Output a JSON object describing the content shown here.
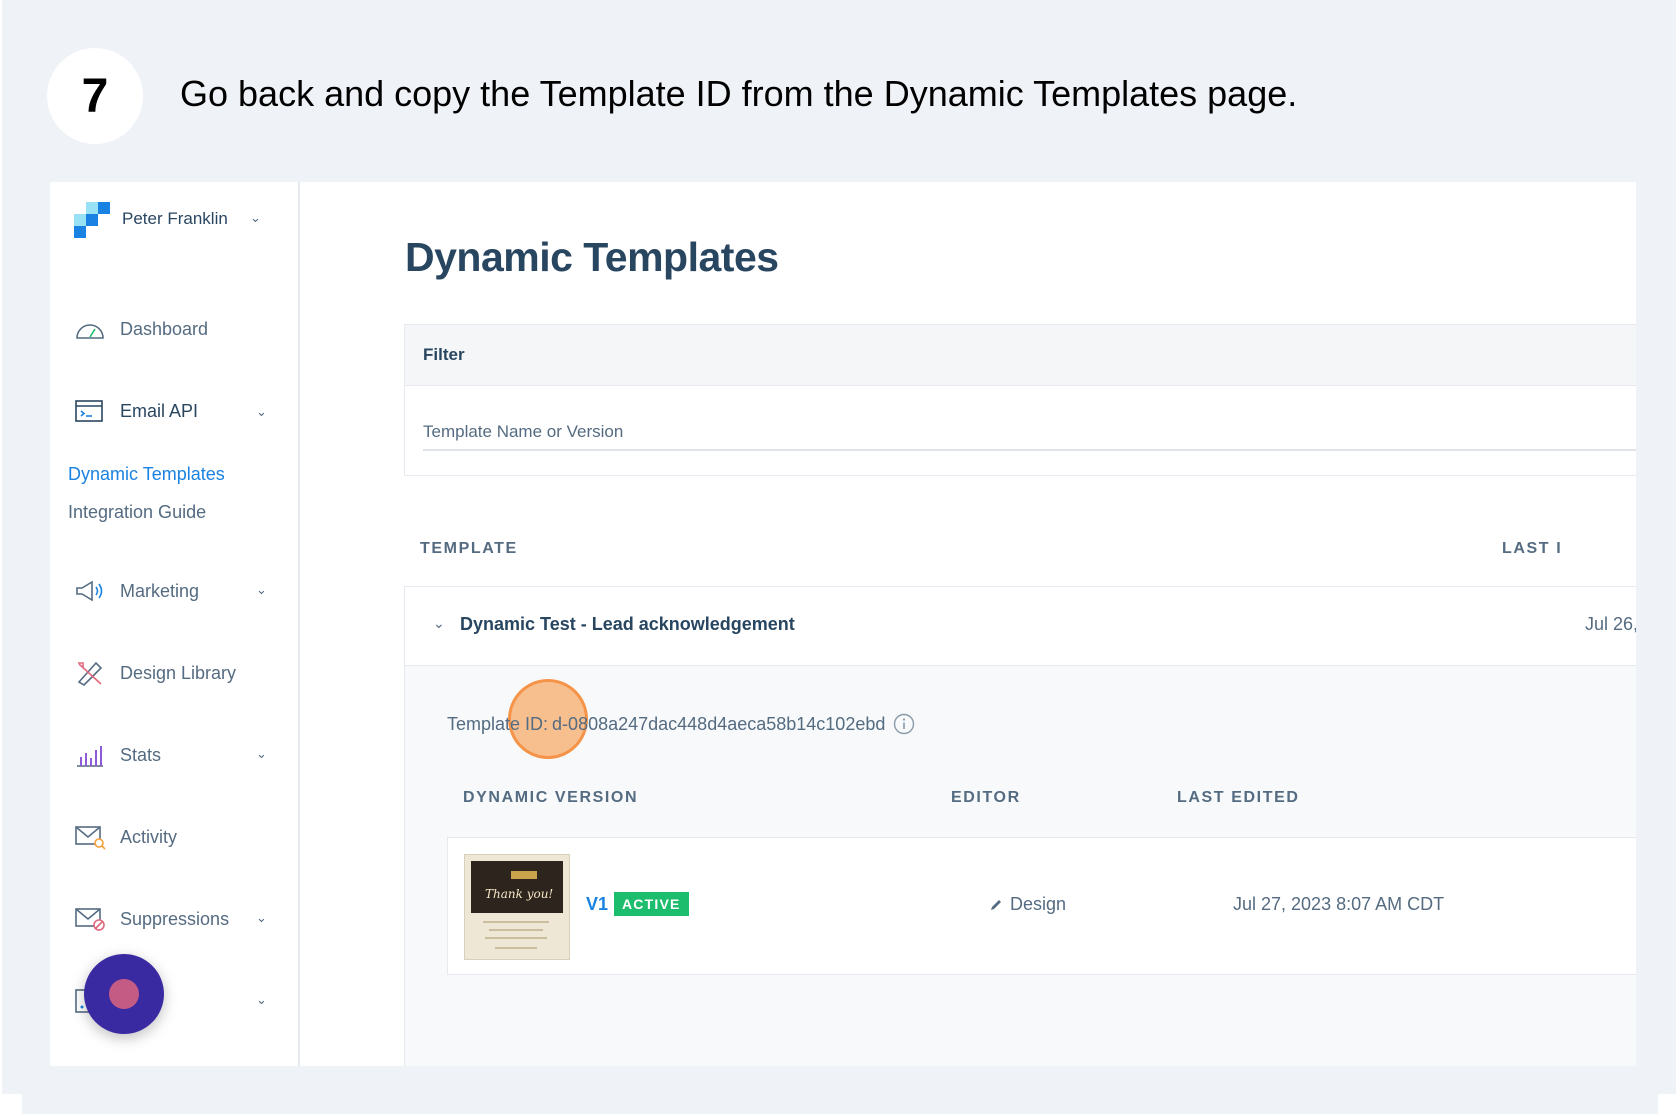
{
  "step": {
    "number": "7",
    "instruction": "Go back and copy the Template ID from the Dynamic Templates page."
  },
  "colors": {
    "accent": "#1a82e2",
    "heading": "#294661",
    "muted": "#546b81",
    "active_badge": "#1cbd6c",
    "highlight": "#f8a660",
    "fab": "#3a2aa1"
  },
  "sidebar": {
    "user_name": "Peter Franklin",
    "items": [
      {
        "label": "Dashboard",
        "icon": "gauge-icon"
      },
      {
        "label": "Email API",
        "icon": "terminal-window-icon"
      },
      {
        "label": "Marketing",
        "icon": "megaphone-icon"
      },
      {
        "label": "Design Library",
        "icon": "pencil-ruler-icon"
      },
      {
        "label": "Stats",
        "icon": "bar-chart-icon"
      },
      {
        "label": "Activity",
        "icon": "envelope-search-icon"
      },
      {
        "label": "Suppressions",
        "icon": "envelope-block-icon"
      },
      {
        "label": "ings",
        "icon": "settings-grid-icon"
      }
    ],
    "email_api_subitems": [
      {
        "label": "Dynamic Templates",
        "current": true
      },
      {
        "label": "Integration Guide",
        "current": false
      }
    ]
  },
  "main": {
    "title": "Dynamic Templates",
    "filter": {
      "header": "Filter",
      "placeholder": "Template Name or Version"
    },
    "table": {
      "columns": [
        "TEMPLATE",
        "LAST I"
      ],
      "templates": [
        {
          "name": "Dynamic Test - Lead acknowledgement",
          "last_edited": "Jul 26,",
          "template_id_label": "Template ID:",
          "template_id": "d-0808a247dac448d4aeca58b14c102ebd",
          "version_columns": [
            "DYNAMIC VERSION",
            "EDITOR",
            "LAST EDITED"
          ],
          "versions": [
            {
              "thumbnail_text": "Thank you!",
              "name": "V1",
              "status": "ACTIVE",
              "editor": "Design",
              "last_edited": "Jul 27, 2023 8:07 AM CDT"
            }
          ]
        }
      ]
    }
  }
}
